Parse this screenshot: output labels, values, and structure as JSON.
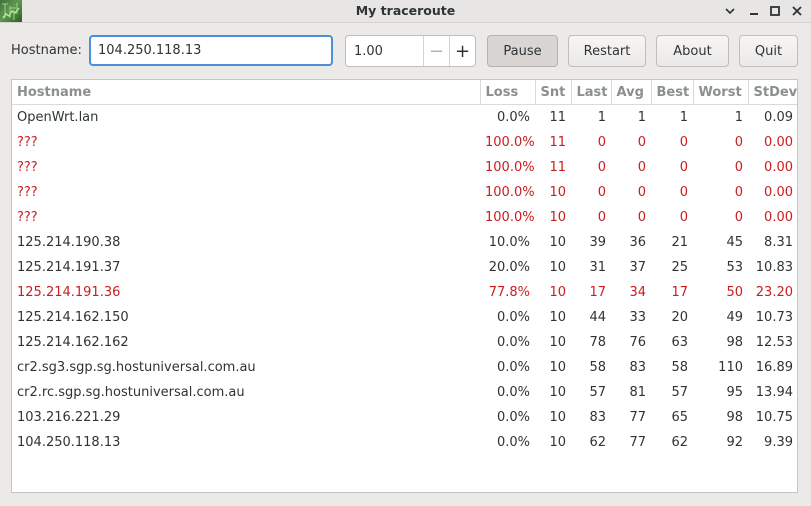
{
  "window": {
    "title": "My traceroute",
    "icon": "mtr-app-icon",
    "controls": [
      "chevron-down-icon",
      "minimize-icon",
      "maximize-icon",
      "close-icon"
    ]
  },
  "toolbar": {
    "hostname_label": "Hostname:",
    "hostname_value": "104.250.118.13",
    "interval_value": "1.00",
    "minus_label": "−",
    "plus_label": "+",
    "pause_label": "Pause",
    "restart_label": "Restart",
    "about_label": "About",
    "quit_label": "Quit"
  },
  "table": {
    "columns": [
      "Hostname",
      "Loss",
      "Snt",
      "Last",
      "Avg",
      "Best",
      "Worst",
      "StDev"
    ],
    "rows": [
      {
        "hostname": "OpenWrt.lan",
        "loss": "0.0%",
        "snt": "11",
        "last": "1",
        "avg": "1",
        "best": "1",
        "worst": "1",
        "stdev": "0.09",
        "status": "ok"
      },
      {
        "hostname": "???",
        "loss": "100.0%",
        "snt": "11",
        "last": "0",
        "avg": "0",
        "best": "0",
        "worst": "0",
        "stdev": "0.00",
        "status": "bad"
      },
      {
        "hostname": "???",
        "loss": "100.0%",
        "snt": "11",
        "last": "0",
        "avg": "0",
        "best": "0",
        "worst": "0",
        "stdev": "0.00",
        "status": "bad"
      },
      {
        "hostname": "???",
        "loss": "100.0%",
        "snt": "10",
        "last": "0",
        "avg": "0",
        "best": "0",
        "worst": "0",
        "stdev": "0.00",
        "status": "bad"
      },
      {
        "hostname": "???",
        "loss": "100.0%",
        "snt": "10",
        "last": "0",
        "avg": "0",
        "best": "0",
        "worst": "0",
        "stdev": "0.00",
        "status": "bad"
      },
      {
        "hostname": "125.214.190.38",
        "loss": "10.0%",
        "snt": "10",
        "last": "39",
        "avg": "36",
        "best": "21",
        "worst": "45",
        "stdev": "8.31",
        "status": "ok"
      },
      {
        "hostname": "125.214.191.37",
        "loss": "20.0%",
        "snt": "10",
        "last": "31",
        "avg": "37",
        "best": "25",
        "worst": "53",
        "stdev": "10.83",
        "status": "ok"
      },
      {
        "hostname": "125.214.191.36",
        "loss": "77.8%",
        "snt": "10",
        "last": "17",
        "avg": "34",
        "best": "17",
        "worst": "50",
        "stdev": "23.20",
        "status": "bad"
      },
      {
        "hostname": "125.214.162.150",
        "loss": "0.0%",
        "snt": "10",
        "last": "44",
        "avg": "33",
        "best": "20",
        "worst": "49",
        "stdev": "10.73",
        "status": "ok"
      },
      {
        "hostname": "125.214.162.162",
        "loss": "0.0%",
        "snt": "10",
        "last": "78",
        "avg": "76",
        "best": "63",
        "worst": "98",
        "stdev": "12.53",
        "status": "ok"
      },
      {
        "hostname": "cr2.sg3.sgp.sg.hostuniversal.com.au",
        "loss": "0.0%",
        "snt": "10",
        "last": "58",
        "avg": "83",
        "best": "58",
        "worst": "110",
        "stdev": "16.89",
        "status": "ok"
      },
      {
        "hostname": "cr2.rc.sgp.sg.hostuniversal.com.au",
        "loss": "0.0%",
        "snt": "10",
        "last": "57",
        "avg": "81",
        "best": "57",
        "worst": "95",
        "stdev": "13.94",
        "status": "ok"
      },
      {
        "hostname": "103.216.221.29",
        "loss": "0.0%",
        "snt": "10",
        "last": "83",
        "avg": "77",
        "best": "65",
        "worst": "98",
        "stdev": "10.75",
        "status": "ok"
      },
      {
        "hostname": "104.250.118.13",
        "loss": "0.0%",
        "snt": "10",
        "last": "62",
        "avg": "77",
        "best": "62",
        "worst": "92",
        "stdev": "9.39",
        "status": "ok"
      }
    ]
  },
  "colors": {
    "error_text": "#cc1d1d",
    "focus_border": "#4a90d9",
    "header_text": "#8a8f91"
  }
}
